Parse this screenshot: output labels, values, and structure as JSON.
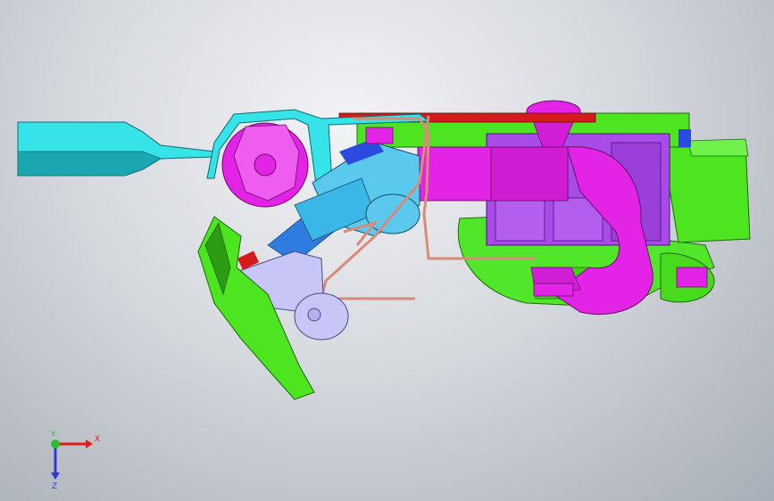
{
  "viewport": {
    "background_top": "#f2f3f6",
    "background_bottom": "#a8aeb7"
  },
  "model": {
    "colors": {
      "cyan": "#35e3e8",
      "cyan_dark": "#1aa7b0",
      "magenta": "#e324e6",
      "magenta_dark": "#a019b0",
      "purple": "#a94be6",
      "green": "#4ce51f",
      "green_dark": "#2c9a12",
      "lavender": "#c7c6f7",
      "copper": "#d98b7a",
      "red": "#d41a1a",
      "blue_light": "#5bc8ee",
      "blue": "#2b4be0"
    }
  },
  "triad": {
    "x_label": "X",
    "y_label": "Y",
    "z_label": "Z",
    "x_color": "#e11b1b",
    "y_color": "#2bbf2b",
    "z_color": "#2c37d6"
  }
}
